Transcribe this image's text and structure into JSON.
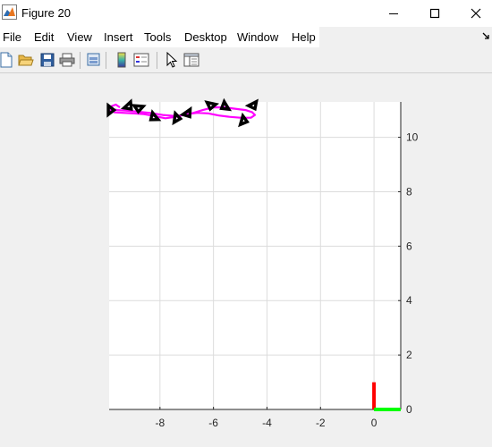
{
  "window": {
    "title": "Figure 20"
  },
  "menu": {
    "items": [
      "File",
      "Edit",
      "View",
      "Insert",
      "Tools",
      "Desktop",
      "Window",
      "Help"
    ]
  },
  "toolbar": {
    "buttons": [
      {
        "icon": "new-figure-icon"
      },
      {
        "icon": "open-file-icon"
      },
      {
        "icon": "save-icon"
      },
      {
        "icon": "print-icon"
      },
      {
        "icon": "link-plot-icon"
      },
      {
        "icon": "insert-colorbar-icon"
      },
      {
        "icon": "insert-legend-icon"
      },
      {
        "icon": "edit-plot-cursor-icon"
      },
      {
        "icon": "property-inspector-icon"
      }
    ]
  },
  "chart_data": {
    "type": "line",
    "title": "",
    "xlabel": "",
    "ylabel": "",
    "xlim": [
      -9.9,
      1.0
    ],
    "ylim": [
      0,
      11.3
    ],
    "xticks": [
      -8,
      -6,
      -4,
      -2,
      0
    ],
    "yticks": [
      0,
      2,
      4,
      6,
      8,
      10
    ],
    "xtick_labels": [
      "-8",
      "-6",
      "-4",
      "-2",
      "0"
    ],
    "ytick_labels": [
      "0",
      "2",
      "4",
      "6",
      "8",
      "10"
    ],
    "y_axis_location": "right",
    "grid": true,
    "series": [
      {
        "style": "magenta-path",
        "color": "#ff00ff",
        "x": [
          -9.85,
          -9.6,
          -9.3,
          -8.9,
          -8.4,
          -7.9,
          -7.4,
          -6.9,
          -6.4,
          -6.0,
          -5.6,
          -5.2,
          -4.8,
          -4.55,
          -4.45,
          -4.6,
          -5.0,
          -5.4,
          -5.8,
          -6.2,
          -6.6,
          -7.0,
          -7.4,
          -7.8,
          -8.2,
          -8.6,
          -9.0,
          -9.4,
          -9.7,
          -9.85,
          -9.8,
          -9.65,
          -9.5
        ],
        "y": [
          11.05,
          11.0,
          10.98,
          10.95,
          10.9,
          10.82,
          10.78,
          10.85,
          11.0,
          11.1,
          11.1,
          11.05,
          11.0,
          10.92,
          10.82,
          10.72,
          10.72,
          10.75,
          10.8,
          10.88,
          10.9,
          10.85,
          10.75,
          10.7,
          10.78,
          10.85,
          10.88,
          10.9,
          10.92,
          10.98,
          11.15,
          11.2,
          11.1
        ]
      }
    ],
    "markers": [
      {
        "style": "black-vehicle-triangle",
        "x": -9.83,
        "y": 11.0
      },
      {
        "style": "black-vehicle-triangle",
        "x": -9.15,
        "y": 11.12
      },
      {
        "style": "black-vehicle-triangle",
        "x": -8.8,
        "y": 11.05
      },
      {
        "style": "black-vehicle-triangle",
        "x": -8.25,
        "y": 10.72
      },
      {
        "style": "black-vehicle-triangle",
        "x": -7.35,
        "y": 10.7
      },
      {
        "style": "black-vehicle-triangle",
        "x": -6.95,
        "y": 10.85
      },
      {
        "style": "black-vehicle-triangle",
        "x": -6.1,
        "y": 11.15
      },
      {
        "style": "black-vehicle-triangle",
        "x": -5.6,
        "y": 11.12
      },
      {
        "style": "black-vehicle-triangle",
        "x": -4.85,
        "y": 10.6
      },
      {
        "style": "black-vehicle-triangle",
        "x": -4.5,
        "y": 11.15
      }
    ],
    "axes_frame": [
      {
        "axis": "y",
        "color": "#ff0000",
        "x": [
          0,
          0
        ],
        "y": [
          0,
          1.0
        ]
      },
      {
        "axis": "x",
        "color": "#00ff00",
        "x": [
          0,
          1.0
        ],
        "y": [
          0,
          0
        ]
      }
    ]
  }
}
